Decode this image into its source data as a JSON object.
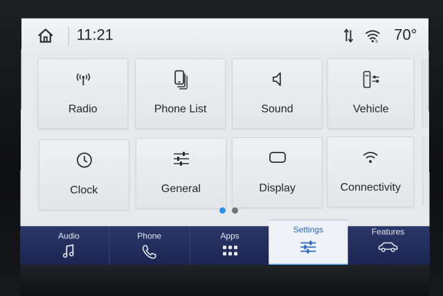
{
  "status": {
    "time": "11:21",
    "temperature": "70°"
  },
  "tiles": [
    {
      "label": "Radio",
      "icon": "radio-antenna-icon"
    },
    {
      "label": "Phone List",
      "icon": "phone-list-icon"
    },
    {
      "label": "Sound",
      "icon": "speaker-icon"
    },
    {
      "label": "Vehicle",
      "icon": "vehicle-settings-icon"
    },
    {
      "label": "Clock",
      "icon": "clock-icon"
    },
    {
      "label": "General",
      "icon": "sliders-icon"
    },
    {
      "label": "Display",
      "icon": "display-icon"
    },
    {
      "label": "Connectivity",
      "icon": "wifi-icon"
    }
  ],
  "pagination": {
    "current": 1,
    "total": 2
  },
  "nav": {
    "items": [
      {
        "label": "Audio",
        "icon": "music-note-icon"
      },
      {
        "label": "Phone",
        "icon": "phone-handset-icon"
      },
      {
        "label": "Apps",
        "icon": "apps-grid-icon"
      },
      {
        "label": "Settings",
        "icon": "settings-sliders-icon"
      },
      {
        "label": "Features",
        "icon": "car-features-icon"
      }
    ],
    "active": "Settings"
  },
  "colors": {
    "nav_background": "#222d5c",
    "active_accent": "#2a66b8",
    "dot_active": "#2f8ee6",
    "dot_inactive": "#6d7278"
  }
}
